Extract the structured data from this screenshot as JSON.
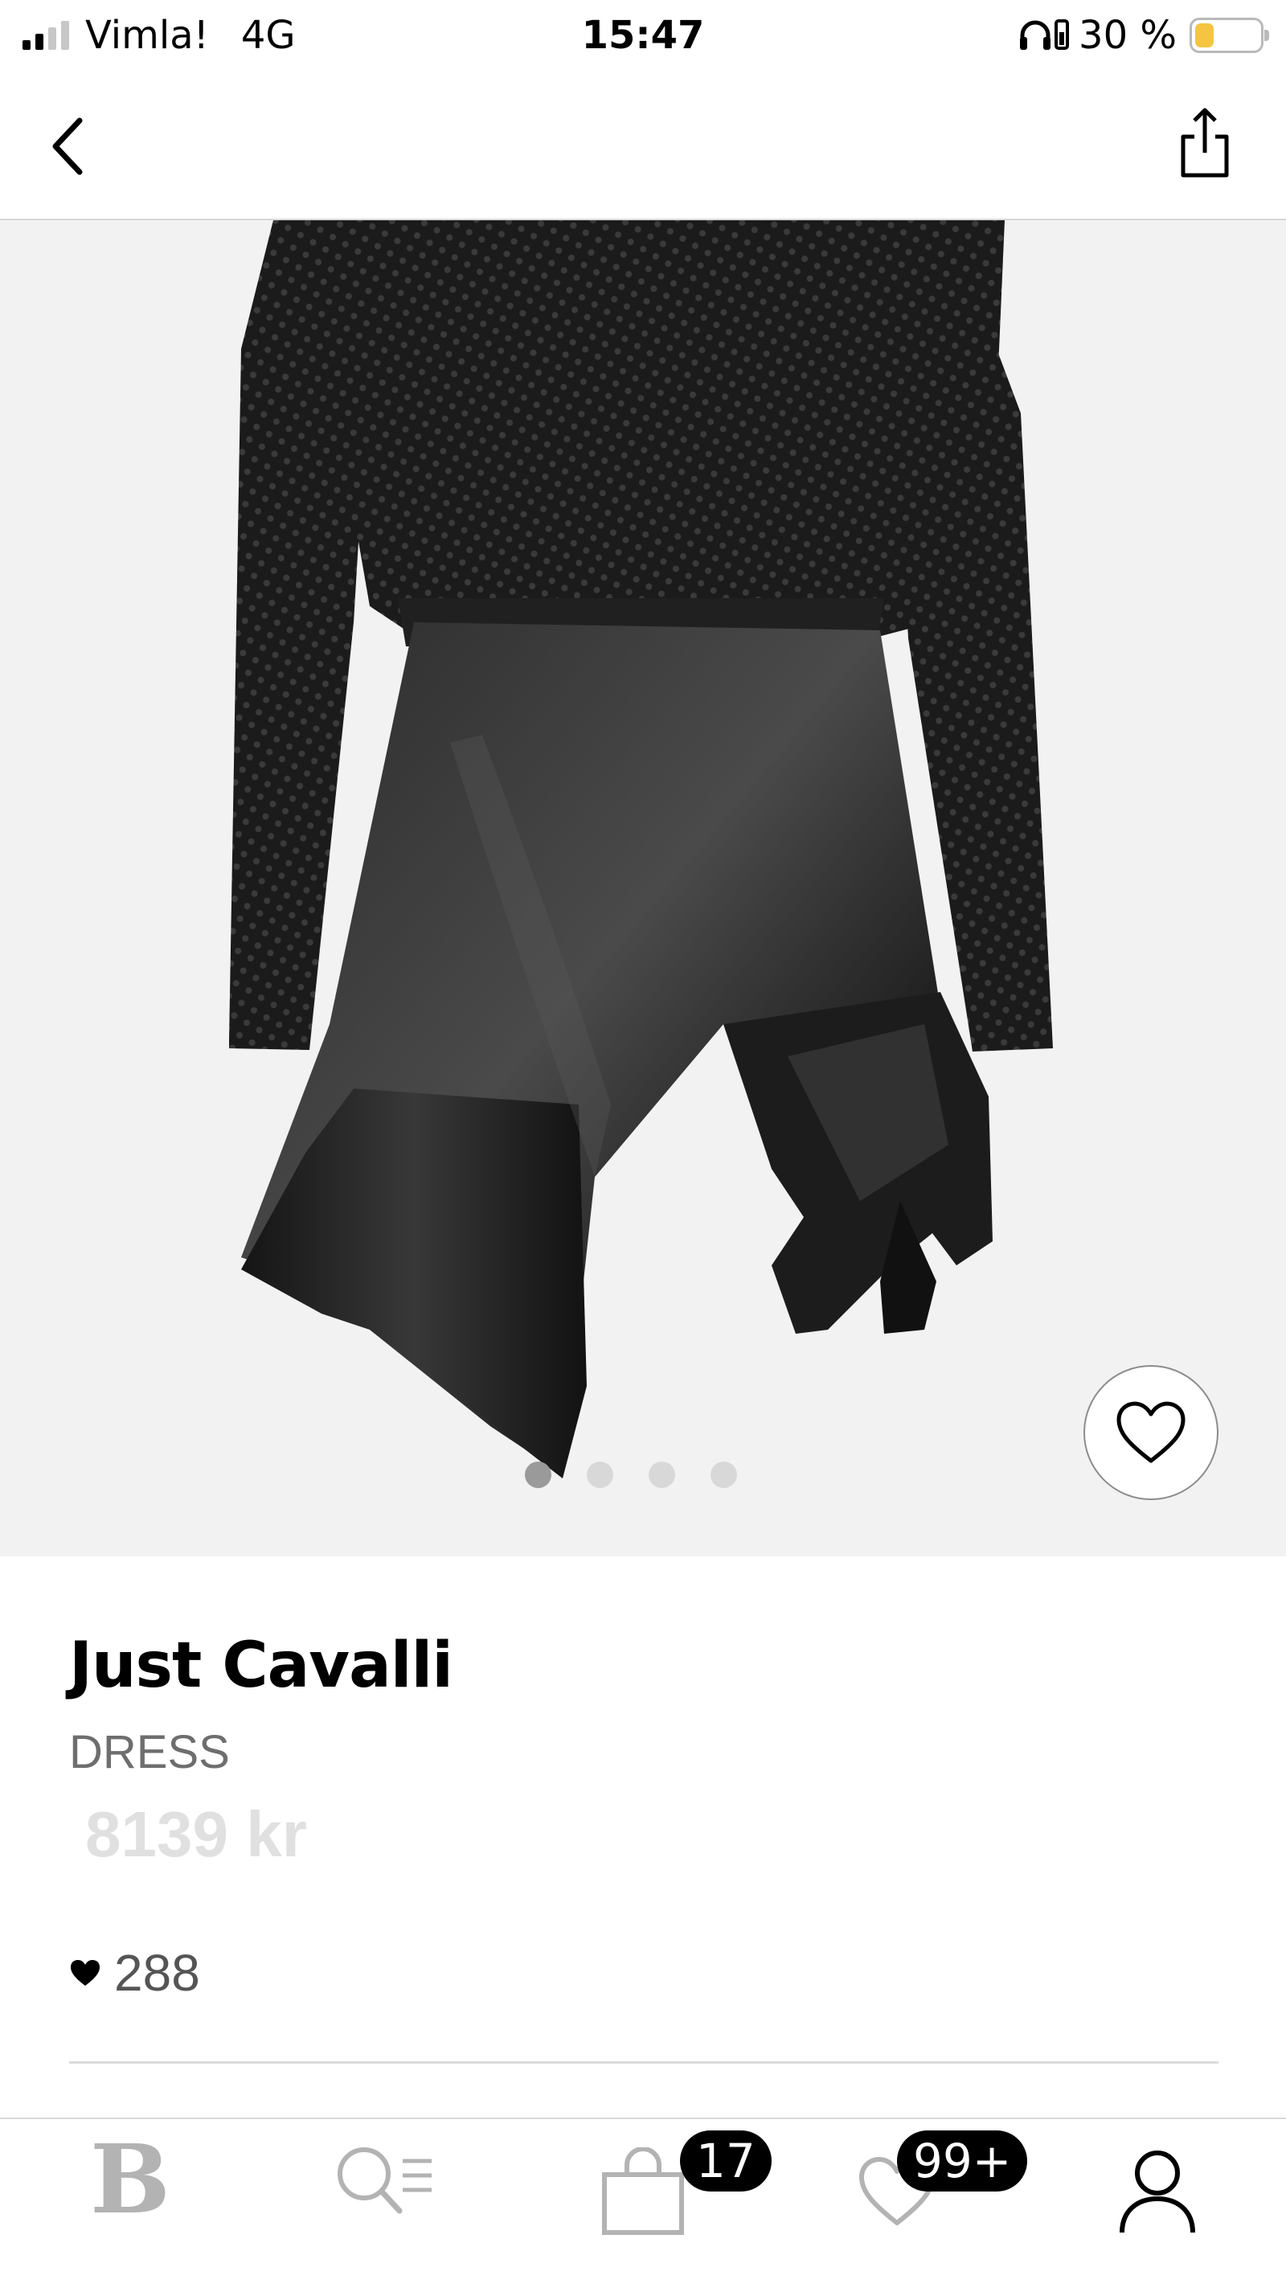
{
  "status_bar": {
    "carrier": "Vimla!",
    "network": "4G",
    "time": "15:47",
    "battery_percent": "30 %",
    "battery_level": 0.3,
    "battery_color": "#f5c542",
    "icons": [
      "signal-icon",
      "headphones-icon",
      "battery-icon"
    ]
  },
  "nav": {
    "back_icon": "chevron-left-icon",
    "share_icon": "share-icon"
  },
  "product": {
    "brand": "Just Cavalli",
    "type": "DRESS",
    "price": "8139 kr",
    "likes": "288",
    "image": "black-mini-dress-image",
    "carousel": {
      "count": 4,
      "active_index": 0
    },
    "favorite_icon": "heart-outline-icon"
  },
  "tab_bar": {
    "items": [
      {
        "name": "home",
        "icon": "b-logo-icon",
        "glyph": "B"
      },
      {
        "name": "search",
        "icon": "search-list-icon"
      },
      {
        "name": "bag",
        "icon": "shopping-bag-icon",
        "badge": "17"
      },
      {
        "name": "wishlist",
        "icon": "heart-outline-icon",
        "badge": "99+"
      },
      {
        "name": "profile",
        "icon": "person-icon"
      }
    ]
  },
  "colors": {
    "badge_bg": "#000000",
    "price_text": "#e0e0e0",
    "image_bg": "#f2f2f2",
    "inactive_tab": "#b3b3b3"
  }
}
